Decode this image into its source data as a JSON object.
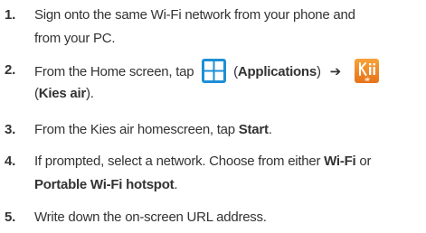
{
  "steps": [
    {
      "number": "1.",
      "line1": "Sign onto the same Wi-Fi network from your phone and",
      "line2": "from your PC."
    },
    {
      "number": "2.",
      "text_a": "From the Home screen, tap",
      "paren_open": "(",
      "apps_label": "Applications",
      "paren_close": ")",
      "arrow": "➔",
      "paren_open_2": "(",
      "kies_label": "Kies air",
      "tail": ")."
    },
    {
      "number": "3.",
      "text_a": "From the Kies air homescreen, tap ",
      "start_label": "Start",
      "tail": "."
    },
    {
      "number": "4.",
      "text_a": "If prompted, select a network. Choose from either ",
      "wifi_label": "Wi-Fi",
      "text_b": " or",
      "hotspot_label": "Portable Wi-Fi hotspot",
      "tail": "."
    },
    {
      "number": "5.",
      "text": "Write down the on-screen URL address."
    }
  ],
  "icons": {
    "applications": "applications-grid-icon",
    "kies_air": "kies-air-app-icon",
    "kies_air_badge": "air"
  },
  "colors": {
    "text": "#333333",
    "apps_icon_blue": "#1e8fd6",
    "kies_icon_orange": "#f28a1c"
  }
}
